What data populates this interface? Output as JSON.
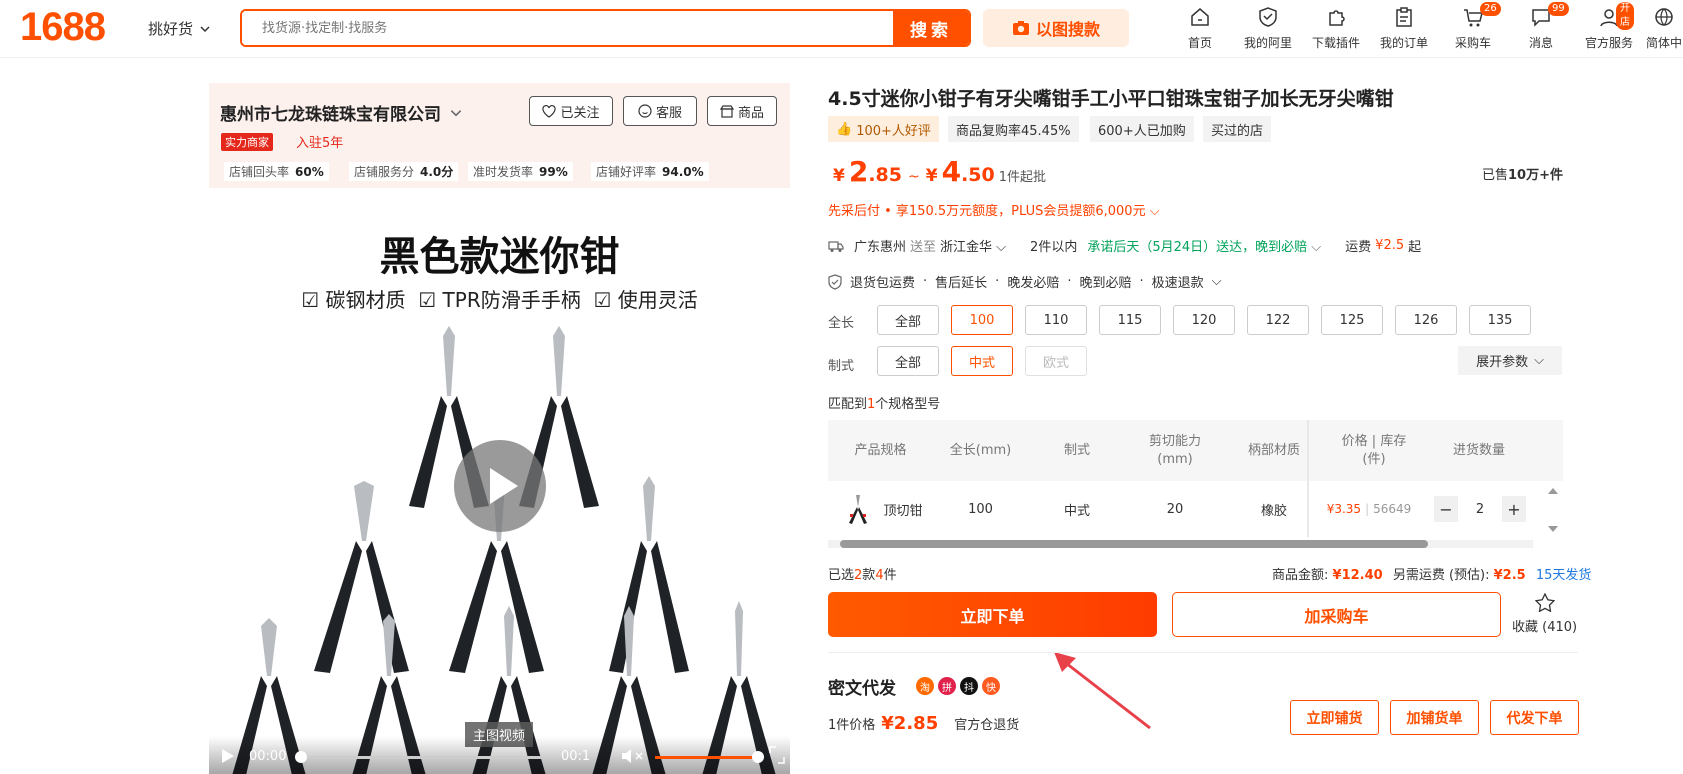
{
  "header": {
    "logo": "1688",
    "pick_label": "挑好货",
    "search_placeholder": "找货源·找定制·找服务",
    "search_button": "搜索",
    "image_search": "以图搜款",
    "nav": [
      {
        "label": "首页",
        "icon": "home-icon"
      },
      {
        "label": "我的阿里",
        "icon": "shield-heart-icon"
      },
      {
        "label": "下载插件",
        "icon": "puzzle-icon"
      },
      {
        "label": "我的订单",
        "icon": "clipboard-icon"
      },
      {
        "label": "采购车",
        "icon": "cart-icon",
        "badge": "26"
      },
      {
        "label": "消息",
        "icon": "message-icon",
        "badge": "99"
      },
      {
        "label": "官方服务",
        "icon": "user-service-icon",
        "badge": "开店"
      },
      {
        "label": "简体中",
        "icon": "globe-icon"
      }
    ]
  },
  "store": {
    "name": "惠州市七龙珠链珠宝有限公司",
    "buttons": {
      "follow": "已关注",
      "service": "客服",
      "goods": "商品"
    },
    "tag": "实力商家",
    "years": "入驻5年",
    "stats": [
      {
        "label": "店铺回头率",
        "value": "60%"
      },
      {
        "label": "店铺服务分",
        "value": "4.0分"
      },
      {
        "label": "准时发货率",
        "value": "99%"
      },
      {
        "label": "店铺好评率",
        "value": "94.0%"
      }
    ]
  },
  "media": {
    "title": "黑色款迷你钳",
    "features": [
      "碳钢材质",
      "TPR防滑手手柄",
      "使用灵活"
    ],
    "video_tag": "主图视频",
    "time_current": "00:00",
    "time_total": "00:1",
    "progress": 0
  },
  "product": {
    "title": "4.5寸迷你小钳子有牙尖嘴钳手工小平口钳珠宝钳子加长无牙尖嘴钳",
    "tags": [
      "100+人好评",
      "商品复购率45.45%",
      "600+人已加购",
      "买过的店"
    ],
    "price_symbol": "¥",
    "price_low_int": "2",
    "price_low_dec": ".85",
    "price_sep": "~",
    "price_high_int": "4",
    "price_high_dec": ".50",
    "min_order": "1件起批",
    "sold_prefix": "已售",
    "sold_value": "10万+件",
    "credit": "先采后付 • 享150.5万元额度，PLUS会员提额6,000元",
    "ship_from": "广东惠州",
    "ship_to_word": "送至",
    "ship_to": "浙江金华",
    "ship_qty": "2件以内",
    "ship_promise": "承诺后天（5月24日）送达，晚到必赔",
    "freight_label": "运费",
    "freight_value": "¥2.5",
    "freight_suffix": "起",
    "services": [
      "退货包运费",
      "售后延长",
      "晚发必赔",
      "晚到必赔",
      "极速退款"
    ],
    "length_label": "全长",
    "length_options": [
      "全部",
      "100",
      "110",
      "115",
      "120",
      "122",
      "125",
      "126",
      "135"
    ],
    "style_label": "制式",
    "style_options": [
      "全部",
      "中式",
      "欧式"
    ],
    "expand": "展开参数",
    "match_prefix": "匹配到",
    "match_count": "1",
    "match_suffix": "个规格型号"
  },
  "table": {
    "headers": [
      "产品规格",
      "全长(mm)",
      "制式",
      "剪切能力\n(mm)",
      "柄部材质",
      "价格 | 库存\n(件)",
      "进货数量"
    ],
    "row": {
      "spec": "顶切钳",
      "length": "100",
      "style": "中式",
      "cut": "20",
      "material": "橡胶",
      "price": "¥3.35",
      "stock": "56649",
      "qty": "2"
    }
  },
  "summary": {
    "selected_prefix": "已选",
    "selected_kinds": "2",
    "selected_mid": "款",
    "selected_pieces": "4",
    "selected_suffix": "件",
    "amount_label": "商品金额:",
    "amount_value": "¥12.40",
    "fee_label": "另需运费 (预估):",
    "fee_value": "¥2.5",
    "dispatch": "15天发货"
  },
  "actions": {
    "order_now": "立即下单",
    "add_cart": "加采购车",
    "favorite": "收藏 (410)"
  },
  "dropship": {
    "title": "密文代发",
    "platforms": [
      "淘",
      "拼",
      "抖",
      "快"
    ],
    "unit_label": "1件价格",
    "unit_price": "¥2.85",
    "return_note": "官方仓退货",
    "buttons": [
      "立即铺货",
      "加铺货单",
      "代发下单"
    ]
  },
  "colors": {
    "brand": "#ff5000",
    "price": "#ff4000",
    "green": "#00a35a"
  }
}
